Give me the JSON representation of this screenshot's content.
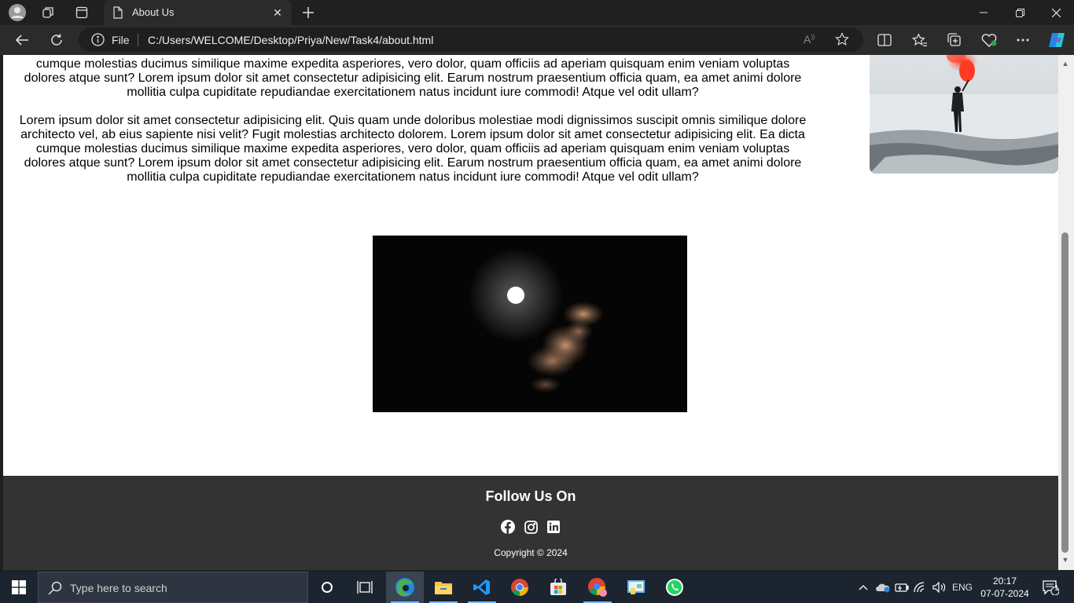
{
  "browser": {
    "tab_title": "About Us",
    "url_scheme": "File",
    "url": "C:/Users/WELCOME/Desktop/Priya/New/Task4/about.html"
  },
  "page": {
    "paragraph_1_lines": [
      "cumque molestias ducimus similique maxime expedita asperiores, vero dolor, quam officiis ad aperiam quisquam enim veniam voluptas",
      "dolores atque sunt? Lorem ipsum dolor sit amet consectetur adipisicing elit. Earum nostrum praesentium officia quam, ea amet animi dolore",
      "mollitia culpa cupiditate repudiandae exercitationem natus incidunt iure commodi! Atque vel odit ullam?"
    ],
    "paragraph_2_lines": [
      "Lorem ipsum dolor sit amet consectetur adipisicing elit. Quis quam unde doloribus molestiae modi dignissimos suscipit omnis similique dolore",
      "architecto vel, ab eius sapiente nisi velit? Fugit molestias architecto dolorem. Lorem ipsum dolor sit amet consectetur adipisicing elit. Ea dicta",
      "cumque molestias ducimus similique maxime expedita asperiores, vero dolor, quam officiis ad aperiam quisquam enim veniam voluptas",
      "dolores atque sunt? Lorem ipsum dolor sit amet consectetur adipisicing elit. Earum nostrum praesentium officia quam, ea amet animi dolore",
      "mollitia culpa cupiditate repudiandae exercitationem natus incidunt iure commodi! Atque vel odit ullam?"
    ]
  },
  "footer": {
    "title": "Follow Us On",
    "socials": [
      "facebook-icon",
      "instagram-icon",
      "linkedin-icon"
    ],
    "copyright": "Copyright © 2024"
  },
  "taskbar": {
    "search_placeholder": "Type here to search",
    "language": "ENG",
    "time": "20:17",
    "date": "07-07-2024",
    "notification_count": "1"
  },
  "colors": {
    "footer_bg": "#333333",
    "browser_chrome": "#202020",
    "taskbar_bg": "#1c2430"
  }
}
